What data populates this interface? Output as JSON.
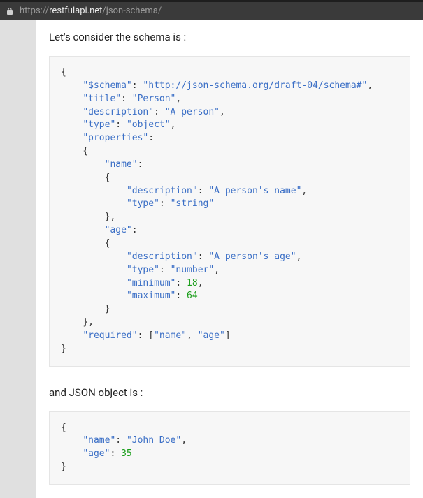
{
  "address_bar": {
    "scheme": "https://",
    "host": "restfulapi.net",
    "path": "/json-schema/"
  },
  "intro1": "Let's consider the schema is :",
  "intro2": "and JSON object is :",
  "schema_code": "{\n    \"$schema\": \"http://json-schema.org/draft-04/schema#\",\n    \"title\": \"Person\",\n    \"description\": \"A person\",\n    \"type\": \"object\",\n    \"properties\":\n    {\n        \"name\":\n        {\n            \"description\": \"A person's name\",\n            \"type\": \"string\"\n        },\n        \"age\":\n        {\n            \"description\": \"A person's age\",\n            \"type\": \"number\",\n            \"minimum\": 18,\n            \"maximum\": 64\n        }\n    },\n    \"required\": [\"name\", \"age\"]\n}",
  "object_code": "{\n    \"name\": \"John Doe\",\n    \"age\": 35\n}"
}
